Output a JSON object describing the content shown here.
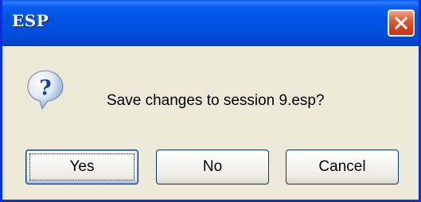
{
  "window": {
    "title": "ESP"
  },
  "titlebar": {
    "close_icon": "close-icon"
  },
  "dialog": {
    "icon": "question-icon",
    "message": "Save changes to session 9.esp?"
  },
  "buttons": {
    "yes": "Yes",
    "no": "No",
    "cancel": "Cancel"
  },
  "colors": {
    "titlebar": "#0054e3",
    "body": "#ece9d8",
    "close_button": "#d2401e"
  }
}
